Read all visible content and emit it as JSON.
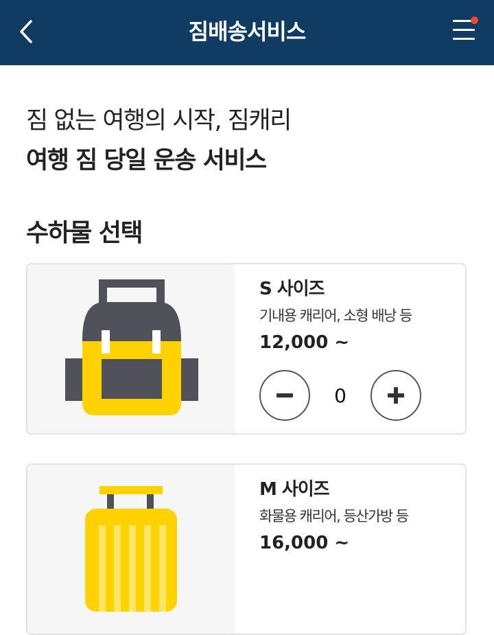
{
  "header": {
    "title": "짐배송서비스",
    "back_icon": "chevron-left-icon",
    "menu_icon": "hamburger-menu-icon",
    "notification_dot_color": "#f2462e",
    "background_color": "#103b62"
  },
  "intro": {
    "line1": "짐 없는 여행의 시작, 짐캐리",
    "line2": "여행 짐 당일 운송 서비스"
  },
  "section": {
    "title": "수하물 선택"
  },
  "items": [
    {
      "size": "S 사이즈",
      "description": "기내용 캐리어, 소형 배낭 등",
      "price": "12,000 ~",
      "quantity": "0",
      "icon": "backpack-icon"
    },
    {
      "size": "M 사이즈",
      "description": "화물용 캐리어, 등산가방 등",
      "price": "16,000 ~",
      "icon": "suitcase-icon"
    }
  ],
  "colors": {
    "accent_yellow": "#ffd200",
    "icon_gray": "#505159"
  }
}
